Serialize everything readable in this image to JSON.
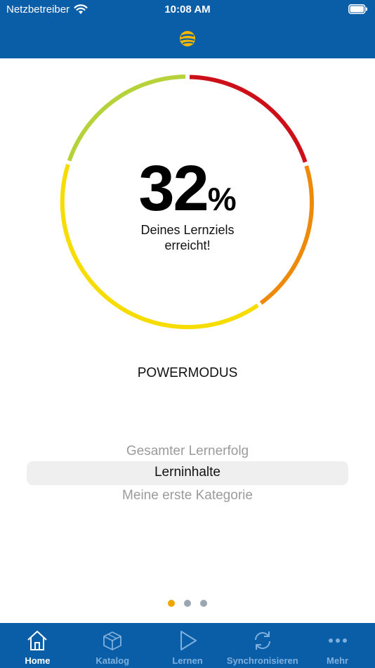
{
  "status": {
    "carrier": "Netzbetreiber",
    "time": "10:08 AM",
    "wifi_icon": "wifi-icon",
    "battery_icon": "battery-icon"
  },
  "header": {
    "logo_icon": "app-logo-globe"
  },
  "progress": {
    "value": "32",
    "unit": "%",
    "caption_line1": "Deines Lernziels",
    "caption_line2": "erreicht!",
    "ring_colors": [
      "#cc0f18",
      "#ee8a07",
      "#f7dc00",
      "#b6d23a"
    ]
  },
  "mode": "POWERMODUS",
  "picker": {
    "options": [
      "Gesamter Lernerfolg",
      "Lerninhalte",
      "Meine erste Kategorie"
    ],
    "selected": "Lerninhalte"
  },
  "pager": {
    "pages": 3,
    "current": 1
  },
  "tabs": [
    {
      "label": "Home",
      "icon": "home-icon",
      "active": true
    },
    {
      "label": "Katalog",
      "icon": "catalog-box-icon",
      "active": false
    },
    {
      "label": "Lernen",
      "icon": "play-icon",
      "active": false
    },
    {
      "label": "Synchronisieren",
      "icon": "sync-icon",
      "active": false
    },
    {
      "label": "Mehr",
      "icon": "more-icon",
      "active": false
    }
  ],
  "colors": {
    "brand_blue": "#0a5ea8",
    "accent_orange": "#f0a500",
    "tab_inactive": "#7fb0dd"
  }
}
